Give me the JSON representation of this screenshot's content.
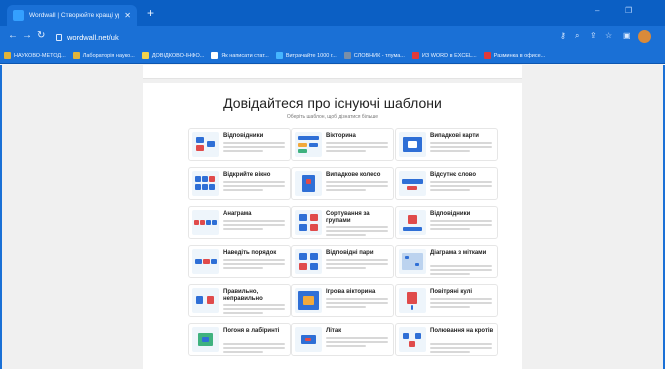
{
  "browser": {
    "tab_title": "Wordwall | Створюйте кращі уро",
    "tab_close": "✕",
    "new_tab": "+",
    "address": "wordwall.net/uk",
    "window_controls": [
      "–",
      "❐"
    ],
    "bookmarks": [
      {
        "label": "НАУКОВО-МЕТОД...",
        "color": "#e0b43a"
      },
      {
        "label": "Лабораторія науко...",
        "color": "#e0b43a"
      },
      {
        "label": "ДОВІДКОВО-ІНФО...",
        "color": "#f1d24a"
      },
      {
        "label": "Як написати стат...",
        "color": "#ffffff"
      },
      {
        "label": "Витрачайте 1000 г...",
        "color": "#45b5ff"
      },
      {
        "label": "СЛОВНИК - тлума...",
        "color": "#7a8fa8"
      },
      {
        "label": "ИЗ WORD в EXCEL...",
        "color": "#e03a3a"
      },
      {
        "label": "Разминка в офисе...",
        "color": "#e03a3a"
      }
    ]
  },
  "main": {
    "heading": "Довідайтеся про існуючі шаблони",
    "subheading": "Оберіть шаблон, щоб дізнатися більше",
    "templates": [
      {
        "name": "Відповідники",
        "icon": "matching-icon"
      },
      {
        "name": "Вікторина",
        "icon": "quiz-icon"
      },
      {
        "name": "Випадкові карти",
        "icon": "random-cards-icon"
      },
      {
        "name": "Відкрийте вікно",
        "icon": "open-box-icon"
      },
      {
        "name": "Випадкове колесо",
        "icon": "wheel-icon"
      },
      {
        "name": "Відсутнє слово",
        "icon": "missing-word-icon"
      },
      {
        "name": "Анаграма",
        "icon": "anagram-icon"
      },
      {
        "name": "Сортування за групами",
        "icon": "group-sort-icon"
      },
      {
        "name": "Відповідники",
        "icon": "match-up-icon"
      },
      {
        "name": "Наведіть порядок",
        "icon": "unjumble-icon"
      },
      {
        "name": "Відповідні пари",
        "icon": "matching-pairs-icon"
      },
      {
        "name": "Діаграма з мітками",
        "icon": "labelled-diagram-icon"
      },
      {
        "name": "Правильно, неправильно",
        "icon": "true-false-icon"
      },
      {
        "name": "Ігрова вікторина",
        "icon": "gameshow-quiz-icon"
      },
      {
        "name": "Повітряні кулі",
        "icon": "balloon-icon"
      },
      {
        "name": "Погоня в лабіринті",
        "icon": "maze-chase-icon"
      },
      {
        "name": "Літак",
        "icon": "airplane-icon"
      },
      {
        "name": "Полювання на кротів",
        "icon": "whack-a-mole-icon"
      }
    ]
  }
}
